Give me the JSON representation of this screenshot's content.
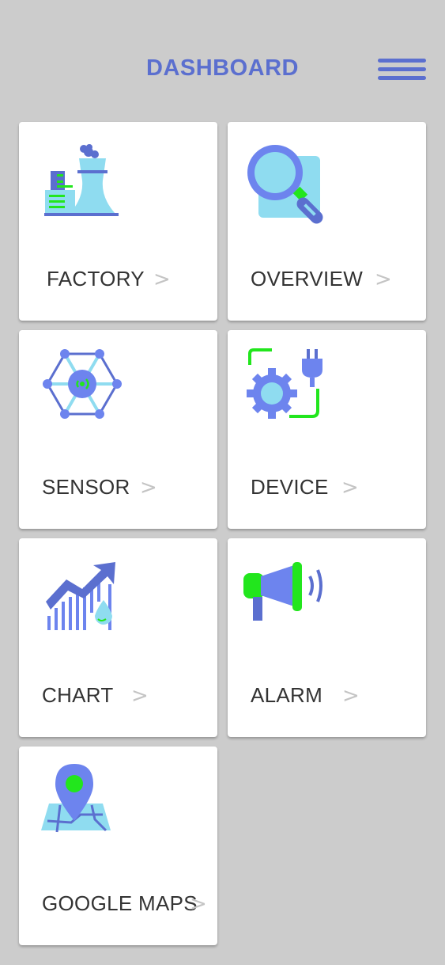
{
  "header": {
    "title": "DASHBOARD"
  },
  "colors": {
    "accent": "#5b6fcf",
    "light_blue": "#8fdcf0",
    "green": "#22e61d",
    "background": "#cccccc"
  },
  "tiles": [
    {
      "label": "FACTORY",
      "icon": "factory-icon",
      "chevron": ">"
    },
    {
      "label": "OVERVIEW",
      "icon": "magnifier-icon",
      "chevron": ">"
    },
    {
      "label": "SENSOR",
      "icon": "sensor-icon",
      "chevron": ">"
    },
    {
      "label": "DEVICE",
      "icon": "device-icon",
      "chevron": ">"
    },
    {
      "label": "CHART",
      "icon": "chart-icon",
      "chevron": ">"
    },
    {
      "label": "ALARM",
      "icon": "alarm-icon",
      "chevron": ">"
    },
    {
      "label": "GOOGLE MAPS",
      "icon": "map-pin-icon",
      "chevron": ">"
    }
  ]
}
